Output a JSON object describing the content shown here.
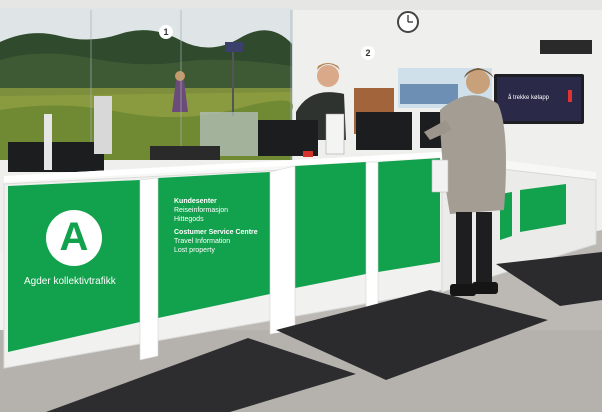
{
  "logo": {
    "letter": "A",
    "name": "Agder kollektivtrafikk"
  },
  "info_panel": {
    "heading_no": "Kundesenter",
    "line_no_1": "Reiseinformasjon",
    "line_no_2": "Hittegods",
    "heading_en": "Costumer Service Centre",
    "line_en_1": "Travel Information",
    "line_en_2": "Lost property"
  },
  "markers": {
    "one": "1",
    "two": "2"
  },
  "tv_screen": {
    "text": "å trekke kølapp"
  },
  "colors": {
    "brand_green": "#12a14c",
    "counter_white": "#f4f4f2",
    "wall": "#efefed",
    "floor": "#b9b6b2",
    "mat": "#2c2c2e"
  }
}
